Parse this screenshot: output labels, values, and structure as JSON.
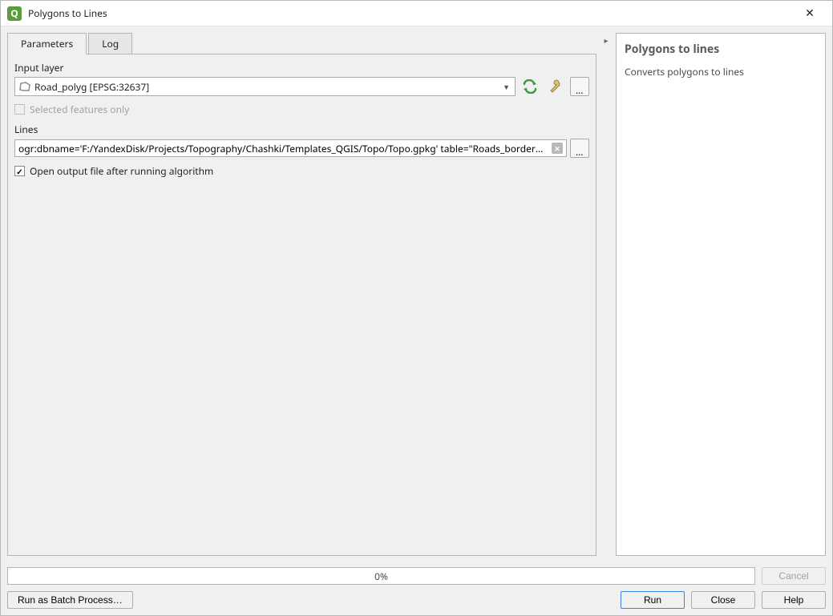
{
  "window": {
    "title": "Polygons to Lines"
  },
  "tabs": {
    "parameters": "Parameters",
    "log": "Log"
  },
  "params": {
    "input_label": "Input layer",
    "input_value": "Road_polyg [EPSG:32637]",
    "selected_only_label": "Selected features only",
    "selected_only_checked": false,
    "selected_only_enabled": false,
    "output_label": "Lines",
    "output_value": "ogr:dbname='F:/YandexDisk/Projects/Topography/Chashki/Templates_QGIS/Topo/Topo.gpkg' table=\"Roads_borders\" (geom)",
    "open_after_label": "Open output file after running algorithm",
    "open_after_checked": true
  },
  "help": {
    "title": "Polygons to lines",
    "description": "Converts polygons to lines"
  },
  "progress": {
    "text": "0%"
  },
  "buttons": {
    "cancel": "Cancel",
    "batch": "Run as Batch Process…",
    "run": "Run",
    "close": "Close",
    "help": "Help"
  }
}
